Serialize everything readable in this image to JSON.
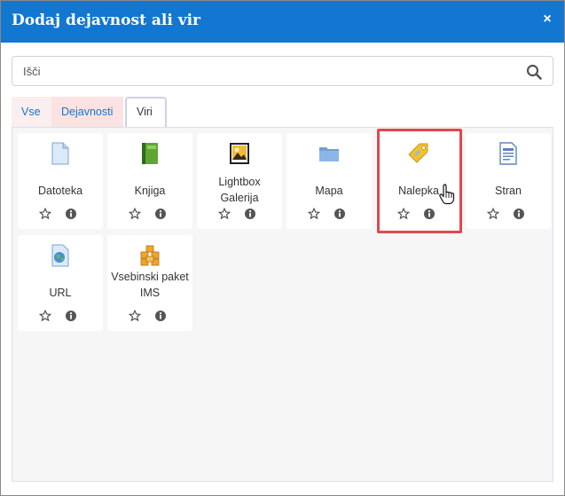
{
  "dialog": {
    "title": "Dodaj dejavnost ali vir",
    "close_symbol": "×"
  },
  "search": {
    "placeholder": "Išči",
    "icon": "search-icon"
  },
  "tabs": [
    {
      "label": "Vse",
      "active": false
    },
    {
      "label": "Dejavnosti",
      "active": false
    },
    {
      "label": "Viri",
      "active": true
    }
  ],
  "items": [
    {
      "name": "Datoteka",
      "icon": "file-icon"
    },
    {
      "name": "Knjiga",
      "icon": "book-icon"
    },
    {
      "name": "Lightbox Galerija",
      "icon": "gallery-icon"
    },
    {
      "name": "Mapa",
      "icon": "folder-icon"
    },
    {
      "name": "Nalepka",
      "icon": "label-tag-icon",
      "highlighted": true
    },
    {
      "name": "Stran",
      "icon": "page-icon"
    },
    {
      "name": "URL",
      "icon": "url-globe-icon"
    },
    {
      "name": "Vsebinski paket IMS",
      "icon": "ims-package-icon"
    }
  ],
  "colors": {
    "header": "#1177d1",
    "highlight": "#e0474e",
    "tab_bg": "#fbe3e3"
  }
}
